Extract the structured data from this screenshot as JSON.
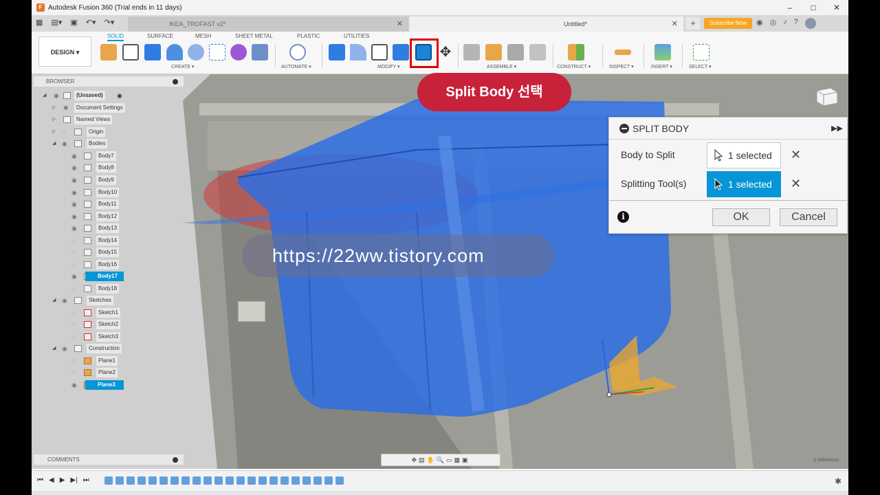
{
  "window": {
    "title": "Autodesk Fusion 360 (Trial ends in 11 days)"
  },
  "tabs": {
    "inactive": "IKEA_TROFAST v2*",
    "active": "Untitled*",
    "subscribe": "Subscribe Now"
  },
  "toolbar": {
    "design": "DESIGN ▾",
    "workspaces": [
      "SOLID",
      "SURFACE",
      "MESH",
      "SHEET METAL",
      "PLASTIC",
      "UTILITIES"
    ],
    "groups": {
      "create": "CREATE ▾",
      "automate": "AUTOMATE ▾",
      "modify": "MODIFY ▾",
      "assemble": "ASSEMBLE ▾",
      "construct": "CONSTRUCT ▾",
      "inspect": "INSPECT ▾",
      "insert": "INSERT ▾",
      "select": "SELECT ▾"
    }
  },
  "browser": {
    "title": "BROWSER",
    "root": "(Unsaved)",
    "items": [
      "Document Settings",
      "Named Views",
      "Origin",
      "Bodies"
    ],
    "bodies": [
      "Body7",
      "Body8",
      "Body9",
      "Body10",
      "Body11",
      "Body12",
      "Body13",
      "Body14",
      "Body15",
      "Body16",
      "Body17",
      "Body18"
    ],
    "sketches_folder": "Sketches",
    "sketches": [
      "Sketch1",
      "Sketch2",
      "Sketch3"
    ],
    "construction_folder": "Construction",
    "planes": [
      "Plane1",
      "Plane2",
      "Plane3"
    ],
    "comments": "COMMENTS"
  },
  "annotation": {
    "label": "Split Body 선택"
  },
  "watermark": "https://22ww.tistory.com",
  "dialog": {
    "title": "SPLIT BODY",
    "body_to_split_label": "Body to Split",
    "body_to_split_value": "1 selected",
    "splitting_tool_label": "Splitting Tool(s)",
    "splitting_tool_value": "1 selected",
    "ok": "OK",
    "cancel": "Cancel"
  },
  "status": {
    "selections": "2 selections"
  },
  "colors": {
    "accent": "#0696d7",
    "annotation": "#c8213a",
    "highlight_border": "#e30000",
    "body_blue": "#2f6fe0"
  }
}
